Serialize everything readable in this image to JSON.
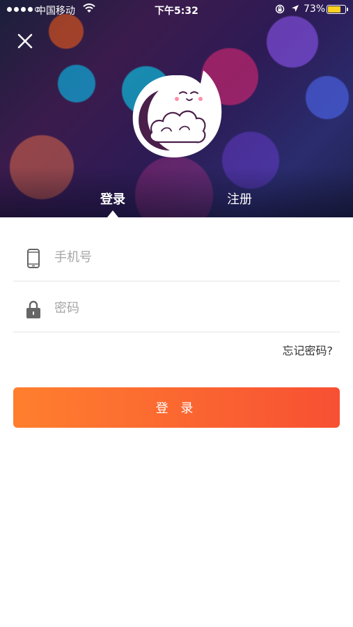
{
  "status_bar": {
    "carrier": "中国移动",
    "time": "下午5:32",
    "battery_percent": "73%",
    "battery_level": 0.73
  },
  "tabs": {
    "login": "登录",
    "register": "注册",
    "active": "login"
  },
  "form": {
    "phone_placeholder": "手机号",
    "password_placeholder": "密码",
    "forgot_password": "忘记密码?",
    "submit_label": "登 录"
  },
  "colors": {
    "button_gradient_start": "#ff7f2e",
    "button_gradient_end": "#f75033",
    "icon_gray": "#666666",
    "battery_yellow": "#ffd21f"
  }
}
